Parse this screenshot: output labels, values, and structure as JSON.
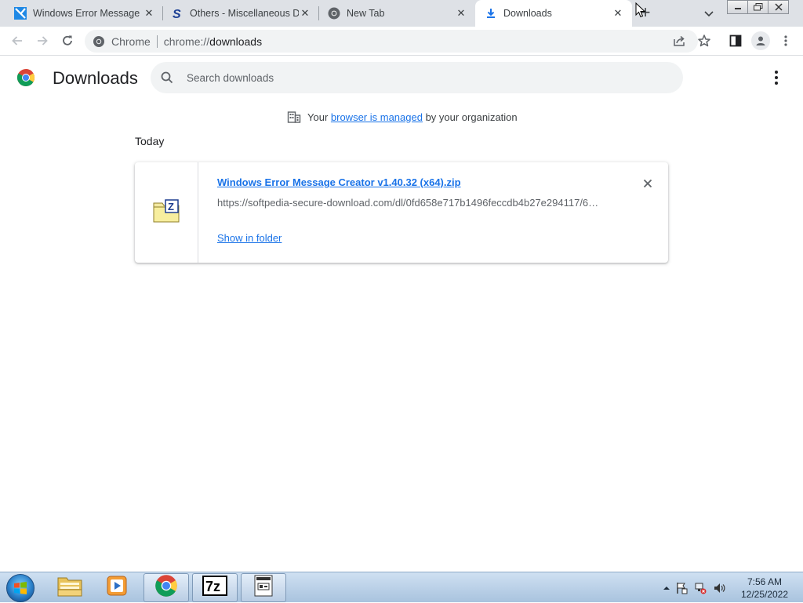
{
  "tabs": [
    {
      "title": "Windows Error Message C",
      "favicon": "softpedia-app-icon",
      "active": false
    },
    {
      "title": "Others - Miscellaneous D",
      "favicon": "softpedia-s-icon",
      "active": false
    },
    {
      "title": "New Tab",
      "favicon": "chrome-icon",
      "active": false
    },
    {
      "title": "Downloads",
      "favicon": "download-icon",
      "active": true
    }
  ],
  "toolbar": {
    "site_chip": "Chrome",
    "url_scheme": "chrome://",
    "url_path": "downloads"
  },
  "page": {
    "title": "Downloads",
    "search_placeholder": "Search downloads"
  },
  "managed": {
    "prefix": "Your ",
    "link": "browser is managed",
    "suffix": " by your organization"
  },
  "section_date": "Today",
  "downloads": [
    {
      "file_name": "Windows Error Message Creator v1.40.32 (x64).zip",
      "url": "https://softpedia-secure-download.com/dl/0fd658e717b1496feccdb4b27e294117/6…",
      "action": "Show in folder",
      "file_icon": "7zip-archive-icon"
    }
  ],
  "taskbar": {
    "apps": [
      "windows-explorer-icon",
      "media-player-icon",
      "chrome-icon",
      "7zip-icon",
      "error-message-creator-icon"
    ],
    "time": "7:56 AM",
    "date": "12/25/2022"
  },
  "colors": {
    "accent": "#1a73e8",
    "tabstrip": "#dee1e6",
    "omnibox": "#f1f3f4"
  }
}
